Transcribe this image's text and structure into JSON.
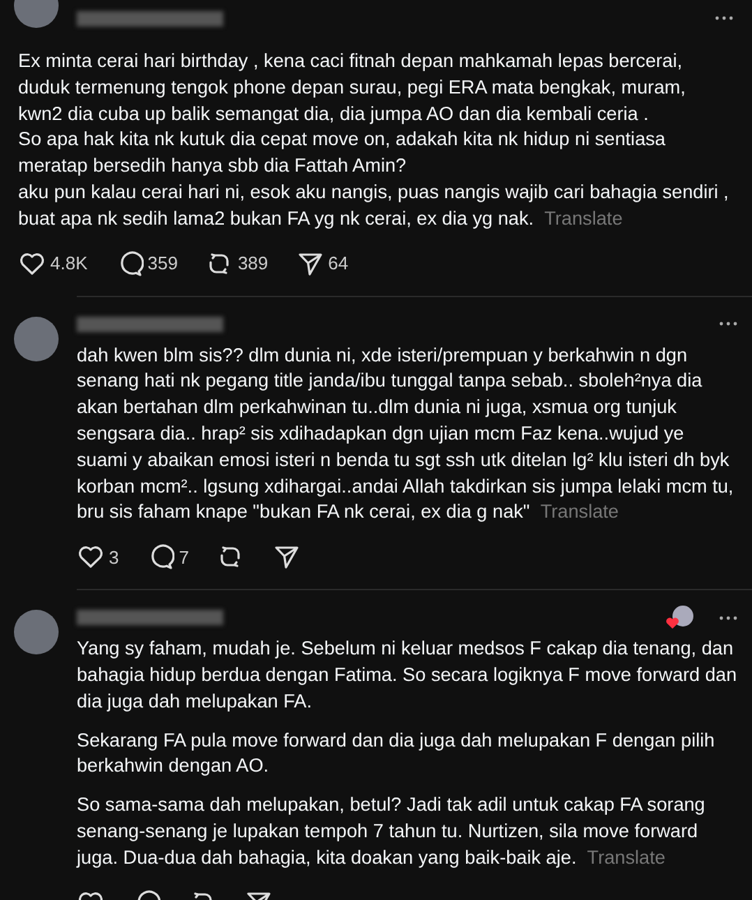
{
  "posts": [
    {
      "kind": "main",
      "paragraphs": [
        "Ex minta cerai hari birthday , kena caci fitnah depan mahkamah lepas bercerai, duduk termenung tengok phone depan surau, pegi ERA mata bengkak, muram, kwn2 dia cuba up balik semangat dia, dia jumpa AO dan dia kembali ceria .\nSo apa hak kita nk kutuk dia cepat move on, adakah kita nk hidup ni sentiasa meratap bersedih hanya sbb dia Fattah Amin?\naku pun kalau cerai hari ni, esok aku nangis, puas nangis wajib cari bahagia sendiri , buat apa nk sedih lama2 bukan FA yg nk cerai, ex dia yg nak."
      ],
      "translate": "Translate",
      "liked_by_author": false,
      "actions": {
        "likes": "4.8K",
        "replies": "359",
        "reposts": "389",
        "shares": "64"
      }
    },
    {
      "kind": "reply",
      "paragraphs": [
        "dah kwen blm sis?? dlm dunia ni, xde isteri/prempuan y berkahwin n dgn senang hati nk pegang title janda/ibu tunggal tanpa sebab.. sboleh²nya dia akan bertahan dlm perkahwinan tu..dlm dunia ni juga, xsmua org tunjuk sengsara dia.. hrap² sis xdihadapkan dgn ujian mcm Faz kena..wujud ye suami y abaikan emosi isteri n benda tu sgt ssh utk ditelan lg² klu isteri dh byk korban mcm².. lgsung xdihargai..andai Allah takdirkan sis jumpa lelaki mcm tu, bru sis faham knape \"bukan FA nk cerai, ex dia g nak\""
      ],
      "translate": "Translate",
      "liked_by_author": false,
      "actions": {
        "likes": "3",
        "replies": "7"
      }
    },
    {
      "kind": "reply",
      "paragraphs": [
        "Yang sy faham, mudah je. Sebelum ni keluar medsos F cakap dia tenang, dan bahagia hidup berdua dengan Fatima. So secara logiknya F move forward dan dia juga dah melupakan FA.",
        "Sekarang FA pula move forward dan dia juga dah melupakan F dengan pilih berkahwin dengan AO.",
        "So sama-sama dah melupakan, betul? Jadi tak adil untuk cakap FA sorang senang-senang je lupakan tempoh 7 tahun tu. Nurtizen, sila move forward juga. Dua-dua dah bahagia, kita doakan yang baik-baik aje."
      ],
      "translate": "Translate",
      "liked_by_author": true
    }
  ]
}
